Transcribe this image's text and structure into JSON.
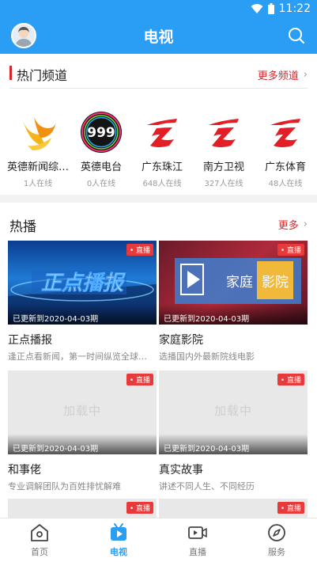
{
  "status_bar": {
    "time": "11:22"
  },
  "header": {
    "title": "电视"
  },
  "hot_channels": {
    "title": "热门频道",
    "more_label": "更多频道",
    "items": [
      {
        "name": "英德新闻综…",
        "online": "1人在线",
        "logo": "yingde-news-logo"
      },
      {
        "name": "英德电台",
        "online": "0人在线",
        "logo": "yingde-radio-999-logo",
        "logo_text": "999"
      },
      {
        "name": "广东珠江",
        "online": "648人在线",
        "logo": "guangdong-tv-logo"
      },
      {
        "name": "南方卫视",
        "online": "327人在线",
        "logo": "guangdong-tv-logo"
      },
      {
        "name": "广东体育",
        "online": "48人在线",
        "logo": "guangdong-tv-logo"
      }
    ]
  },
  "hot_broadcast": {
    "title": "热播",
    "more_label": "更多",
    "items": [
      {
        "title": "正点播报",
        "desc": "逢正点看新闻，第一时间纵览全球…",
        "badge": "• 直播",
        "updated": "已更新到2020-04-03期",
        "thumb_text": "正点播报"
      },
      {
        "title": "家庭影院",
        "desc": "选播国内外最新院线电影",
        "badge": "• 直播",
        "updated": "已更新到2020-04-03期",
        "thumb_text_1": "家庭",
        "thumb_text_2": "影院"
      },
      {
        "title": "和事佬",
        "desc": "专业调解团队为百姓排忧解难",
        "badge": "• 直播",
        "updated": "已更新到2020-04-03期",
        "loading": "加载中"
      },
      {
        "title": "真实故事",
        "desc": "讲述不同人生、不同经历",
        "badge": "• 直播",
        "updated": "已更新到2020-04-03期",
        "loading": "加载中"
      },
      {
        "badge": "• 直播"
      },
      {
        "badge": "• 直播"
      }
    ]
  },
  "bottom_nav": [
    {
      "label": "首页",
      "icon": "home-icon"
    },
    {
      "label": "电视",
      "icon": "tv-icon",
      "active": true
    },
    {
      "label": "直播",
      "icon": "live-video-icon"
    },
    {
      "label": "服务",
      "icon": "compass-icon"
    }
  ],
  "colors": {
    "primary": "#2a9df4",
    "accent_red": "#d6262c",
    "live_badge": "#e83a3a"
  }
}
